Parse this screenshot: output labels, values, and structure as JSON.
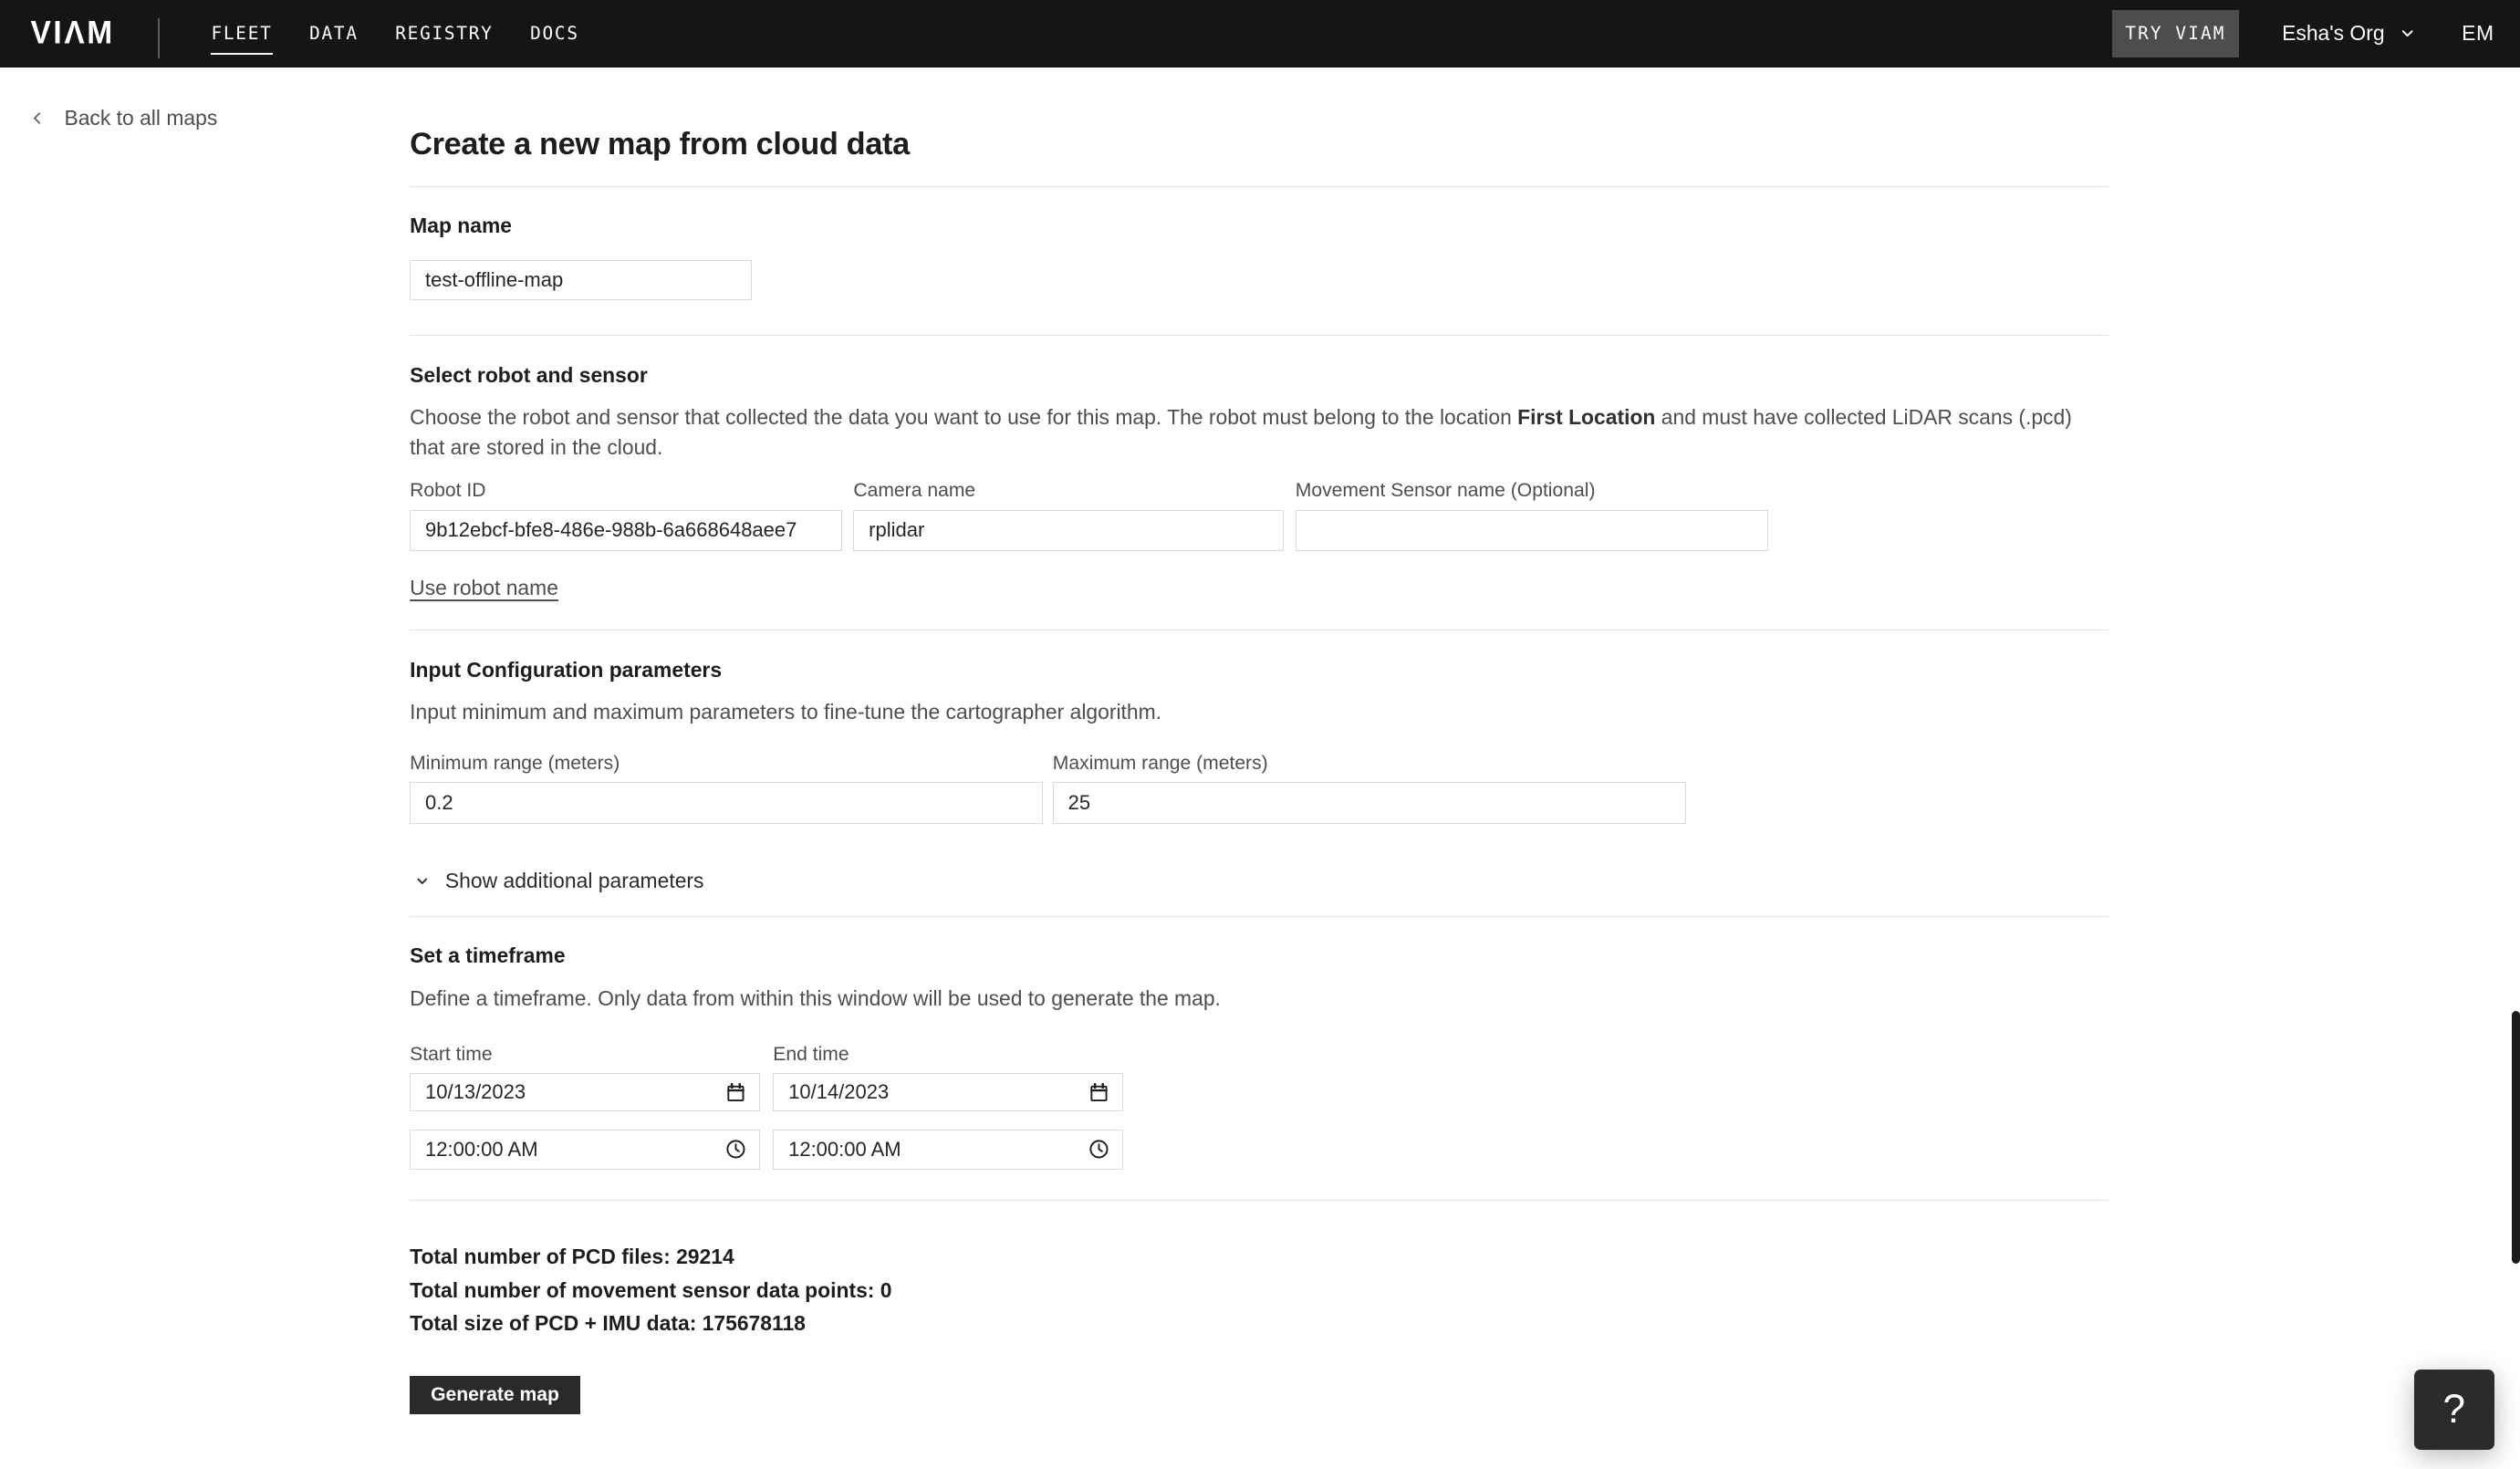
{
  "nav": {
    "logo": "VIΛM",
    "items": [
      {
        "label": "FLEET",
        "active": true
      },
      {
        "label": "DATA",
        "active": false
      },
      {
        "label": "REGISTRY",
        "active": false
      },
      {
        "label": "DOCS",
        "active": false
      }
    ],
    "try_viam_label": "TRY VIAM",
    "org_name": "Esha's Org",
    "user_initials": "EM"
  },
  "back_link": {
    "label": "Back to all maps"
  },
  "page": {
    "title": "Create a new map from cloud data"
  },
  "map_name_section": {
    "heading": "Map name",
    "value": "test-offline-map"
  },
  "robot_section": {
    "heading": "Select robot and sensor",
    "desc_before": "Choose the robot and sensor that collected the data you want to use for this map. The robot must belong to the location ",
    "desc_location": "First Location",
    "desc_after": " and must have collected LiDAR scans (.pcd) that are stored in the cloud.",
    "robot_id": {
      "label": "Robot ID",
      "value": "9b12ebcf-bfe8-486e-988b-6a668648aee7"
    },
    "camera": {
      "label": "Camera name",
      "value": "rplidar"
    },
    "movement": {
      "label": "Movement Sensor name (Optional)",
      "value": ""
    },
    "use_robot_name_label": "Use robot name"
  },
  "config_section": {
    "heading": "Input Configuration parameters",
    "description": "Input minimum and maximum parameters to fine-tune the cartographer algorithm.",
    "min": {
      "label": "Minimum range (meters)",
      "value": "0.2"
    },
    "max": {
      "label": "Maximum range (meters)",
      "value": "25"
    },
    "show_additional_label": "Show additional parameters"
  },
  "timeframe_section": {
    "heading": "Set a timeframe",
    "description": "Define a timeframe. Only data from within this window will be used to generate the map.",
    "start": {
      "label": "Start time",
      "date": "10/13/2023",
      "time": "12:00:00 AM"
    },
    "end": {
      "label": "End time",
      "date": "10/14/2023",
      "time": "12:00:00 AM"
    }
  },
  "summary": {
    "pcd_files": {
      "label": "Total number of PCD files:",
      "value": "29214"
    },
    "movement_points": {
      "label": "Total number of movement sensor data points:",
      "value": "0"
    },
    "total_size": {
      "label": "Total size of PCD + IMU data:",
      "value": "175678118"
    }
  },
  "actions": {
    "generate_label": "Generate map",
    "help_label": "?"
  },
  "colors": {
    "nav_bg": "#151515",
    "button_dark": "#2a2a2a",
    "input_border": "#d9d9d9",
    "text_secondary": "#4e4e4e"
  }
}
